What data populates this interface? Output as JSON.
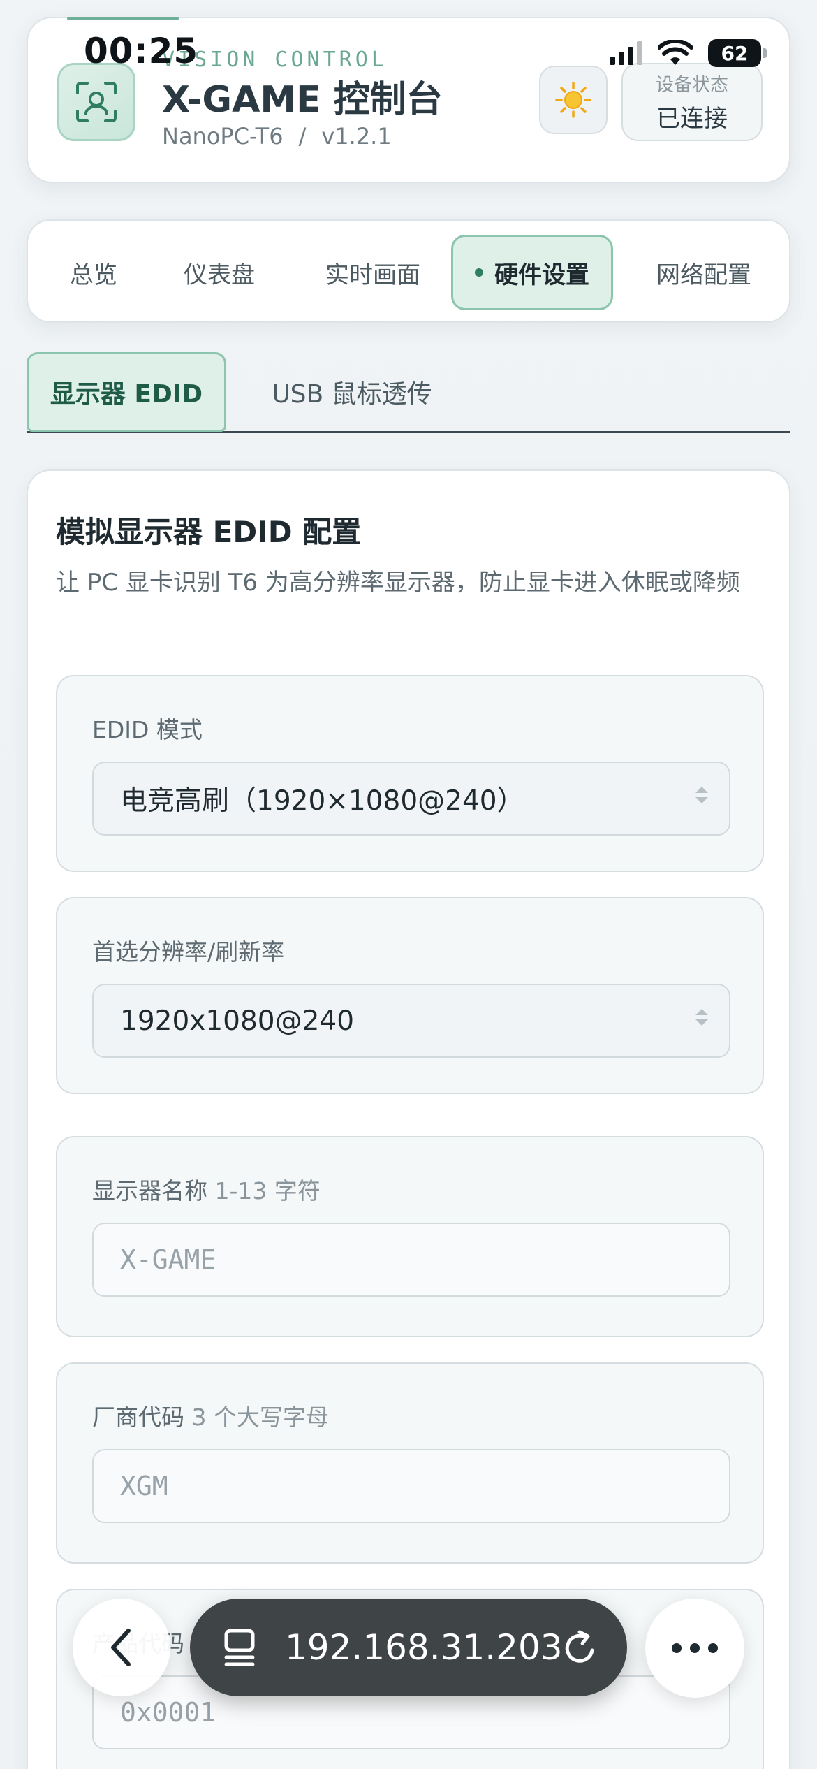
{
  "status_bar": {
    "time": "00:25",
    "battery": "62"
  },
  "header": {
    "eyebrow": "VISION CONTROL",
    "title": "X-GAME 控制台",
    "device": "NanoPC-T6",
    "separator": "/",
    "version": "v1.2.1",
    "status_label": "设备状态",
    "status_value": "已连接"
  },
  "nav": {
    "tabs": [
      {
        "label": "总览"
      },
      {
        "label": "仪表盘"
      },
      {
        "label": "实时画面"
      },
      {
        "label": "硬件设置"
      },
      {
        "label": "网络配置"
      }
    ],
    "active": "硬件设置"
  },
  "sub_tabs": [
    {
      "label": "显示器 EDID"
    },
    {
      "label": "USB 鼠标透传"
    }
  ],
  "section": {
    "title": "模拟显示器 EDID 配置",
    "description": "让 PC 显卡识别 T6 为高分辨率显示器，防止显卡进入休眠或降频"
  },
  "fields": {
    "edid_mode": {
      "label": "EDID 模式",
      "value": "电竞高刷（1920×1080@240）"
    },
    "resolution": {
      "label": "首选分辨率/刷新率",
      "value": "1920x1080@240"
    },
    "monitor_name": {
      "label": "显示器名称",
      "hint": "1-13 字符",
      "placeholder": "X-GAME"
    },
    "vendor_code": {
      "label": "厂商代码",
      "hint": "3 个大写字母",
      "placeholder": "XGM"
    },
    "product_code": {
      "label": "产品代码",
      "placeholder": "0x0001"
    }
  },
  "browser": {
    "url": "192.168.31.203"
  },
  "colors": {
    "accent": "#2f7d63",
    "accent_bg": "#dff0e8",
    "accent_border": "#8cc5ad",
    "url_bar": "#3f4447"
  }
}
